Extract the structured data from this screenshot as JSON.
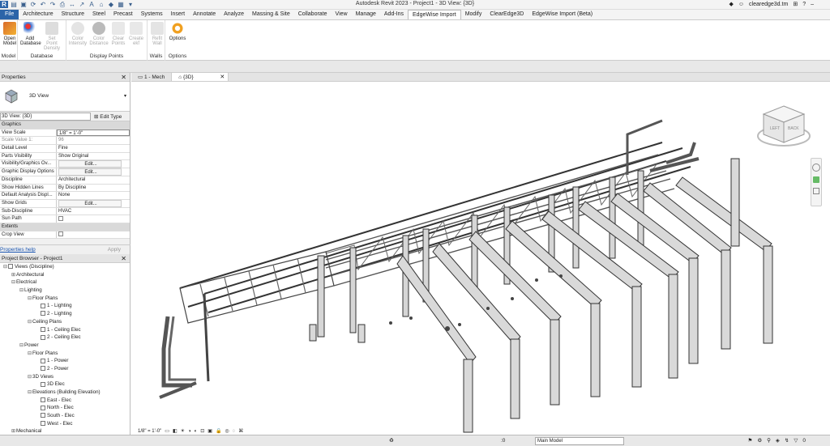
{
  "title_bar": {
    "title": "Autodesk Revit 2023 - Project1 - 3D View: {3D}",
    "user": "clearedge3d.tm"
  },
  "menu": {
    "tabs": [
      "File",
      "Architecture",
      "Structure",
      "Steel",
      "Precast",
      "Systems",
      "Insert",
      "Annotate",
      "Analyze",
      "Massing & Site",
      "Collaborate",
      "View",
      "Manage",
      "Add-Ins",
      "EdgeWise Import",
      "Modify",
      "ClearEdge3D",
      "EdgeWise Import (Beta)"
    ],
    "active": "EdgeWise Import"
  },
  "ribbon": {
    "groups": [
      {
        "label": "Model",
        "buttons": [
          {
            "label": "Open Model",
            "enabled": true
          }
        ]
      },
      {
        "label": "Database",
        "buttons": [
          {
            "label": "Add Database",
            "enabled": true
          },
          {
            "label": "Set Point Density",
            "enabled": false
          }
        ]
      },
      {
        "label": "Display Points",
        "buttons": [
          {
            "label": "Color Intensity",
            "enabled": false
          },
          {
            "label": "Color Distance",
            "enabled": false
          },
          {
            "label": "Clear Points",
            "enabled": false
          },
          {
            "label": "Create ekf",
            "enabled": false
          }
        ]
      },
      {
        "label": "Walls",
        "buttons": [
          {
            "label": "Refit Wall",
            "enabled": false
          }
        ]
      },
      {
        "label": "Options",
        "buttons": [
          {
            "label": "Options",
            "enabled": true
          }
        ]
      }
    ]
  },
  "properties": {
    "header": "Properties",
    "type_name": "3D View",
    "view_selector": "3D View: {3D}",
    "edit_type": "Edit Type",
    "rows": [
      {
        "kind": "cat",
        "key": "Graphics",
        "value": ""
      },
      {
        "kind": "input",
        "key": "View Scale",
        "value": "1/8\" = 1'-0\""
      },
      {
        "kind": "dim",
        "key": "Scale Value    1:",
        "value": "96"
      },
      {
        "kind": "text",
        "key": "Detail Level",
        "value": "Fine"
      },
      {
        "kind": "text",
        "key": "Parts Visibility",
        "value": "Show Original"
      },
      {
        "kind": "button",
        "key": "Visibility/Graphics Ov...",
        "value": "Edit..."
      },
      {
        "kind": "button",
        "key": "Graphic Display Options",
        "value": "Edit..."
      },
      {
        "kind": "text",
        "key": "Discipline",
        "value": "Architectural"
      },
      {
        "kind": "text",
        "key": "Show Hidden Lines",
        "value": "By Discipline"
      },
      {
        "kind": "text",
        "key": "Default Analysis Displ...",
        "value": "None"
      },
      {
        "kind": "button",
        "key": "Show Grids",
        "value": "Edit..."
      },
      {
        "kind": "text",
        "key": "Sub-Discipline",
        "value": "HVAC"
      },
      {
        "kind": "check",
        "key": "Sun Path",
        "value": ""
      },
      {
        "kind": "cat",
        "key": "Extents",
        "value": ""
      },
      {
        "kind": "check",
        "key": "Crop View",
        "value": ""
      }
    ],
    "help_link": "Properties help",
    "apply": "Apply"
  },
  "project_browser": {
    "header": "Project Browser - Project1",
    "nodes": [
      {
        "level": 0,
        "toggle": "-",
        "label": "Views (Discipline)",
        "icon": true
      },
      {
        "level": 1,
        "toggle": "+",
        "label": "Architectural",
        "icon": false
      },
      {
        "level": 1,
        "toggle": "-",
        "label": "Electrical",
        "icon": false
      },
      {
        "level": 2,
        "toggle": "-",
        "label": "Lighting",
        "icon": false
      },
      {
        "level": 3,
        "toggle": "-",
        "label": "Floor Plans",
        "icon": false
      },
      {
        "level": 4,
        "toggle": "",
        "label": "1 - Lighting",
        "icon": true
      },
      {
        "level": 4,
        "toggle": "",
        "label": "2 - Lighting",
        "icon": true
      },
      {
        "level": 3,
        "toggle": "-",
        "label": "Ceiling Plans",
        "icon": false
      },
      {
        "level": 4,
        "toggle": "",
        "label": "1 - Ceiling Elec",
        "icon": true
      },
      {
        "level": 4,
        "toggle": "",
        "label": "2 - Ceiling Elec",
        "icon": true
      },
      {
        "level": 2,
        "toggle": "-",
        "label": "Power",
        "icon": false
      },
      {
        "level": 3,
        "toggle": "-",
        "label": "Floor Plans",
        "icon": false
      },
      {
        "level": 4,
        "toggle": "",
        "label": "1 - Power",
        "icon": true
      },
      {
        "level": 4,
        "toggle": "",
        "label": "2 - Power",
        "icon": true
      },
      {
        "level": 3,
        "toggle": "-",
        "label": "3D Views",
        "icon": false
      },
      {
        "level": 4,
        "toggle": "",
        "label": "3D Elec",
        "icon": true
      },
      {
        "level": 3,
        "toggle": "-",
        "label": "Elevations (Building Elevation)",
        "icon": false
      },
      {
        "level": 4,
        "toggle": "",
        "label": "East - Elec",
        "icon": true
      },
      {
        "level": 4,
        "toggle": "",
        "label": "North - Elec",
        "icon": true
      },
      {
        "level": 4,
        "toggle": "",
        "label": "South - Elec",
        "icon": true
      },
      {
        "level": 4,
        "toggle": "",
        "label": "West - Elec",
        "icon": true
      },
      {
        "level": 1,
        "toggle": "+",
        "label": "Mechanical",
        "icon": false
      }
    ]
  },
  "view_tabs": [
    {
      "label": "1 - Mech",
      "active": false
    },
    {
      "label": "{3D}",
      "active": true
    }
  ],
  "viewcube": {
    "left": "LEFT",
    "back": "BACK"
  },
  "view_control": {
    "scale": "1/8\" = 1'-0\""
  },
  "status": {
    "zero": ":0",
    "model": "Main Model",
    "ref": "0"
  },
  "colors": {
    "file_tab": "#2c64a8",
    "structure": "#555555",
    "link": "#1a55b0"
  }
}
